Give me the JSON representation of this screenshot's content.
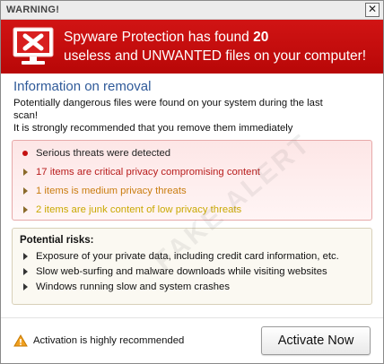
{
  "window": {
    "title": "WARNING!",
    "close_label": "✕"
  },
  "banner": {
    "icon": "monitor-x-icon",
    "line1_prefix": "Spyware Protection has found ",
    "count": "20",
    "line2": "useless and UNWANTED files on your computer!",
    "color": "#c40b0b"
  },
  "info": {
    "title": "Information on removal",
    "line1": "Potentially dangerous files were found on your system during the last",
    "line2": "scan!",
    "line3": "It is strongly recommended that you remove them immediately"
  },
  "threats": [
    {
      "text": "Serious threats were detected",
      "color": "#222222",
      "icon": "red-dot-icon"
    },
    {
      "text": "17 items are critical privacy compromising content",
      "color": "#b81d1d",
      "icon": "triangle-bullet-icon"
    },
    {
      "text": "1 items is medium privacy threats",
      "color": "#c97d10",
      "icon": "triangle-bullet-icon"
    },
    {
      "text": "2 items are junk content of low privacy threats",
      "color": "#c9a800",
      "icon": "triangle-bullet-icon"
    }
  ],
  "risks": {
    "title": "Potential risks:",
    "items": [
      "Exposure of your private data, including credit card information, etc.",
      "Slow web-surfing and malware downloads while visiting websites",
      "Windows running slow and system crashes"
    ]
  },
  "footer": {
    "warning_text": "Activation is highly recommended",
    "warning_icon": "warning-triangle-icon",
    "button_label": "Activate Now"
  },
  "watermark": "FAKE ALERT"
}
